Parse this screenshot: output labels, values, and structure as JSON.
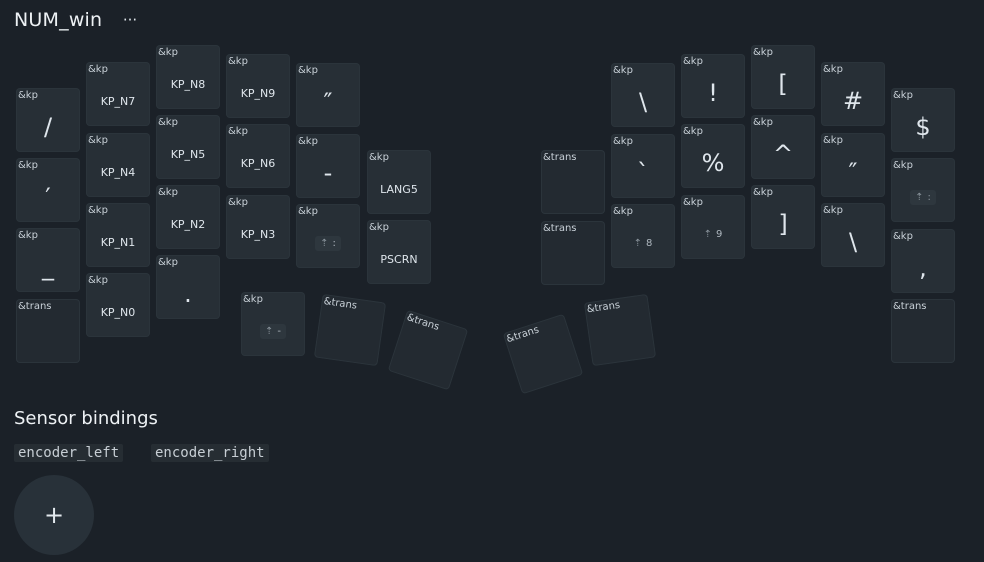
{
  "layer": {
    "title": "NUM_win",
    "menu": "···"
  },
  "keys": {
    "k1": {
      "behavior": "&kp",
      "param": "/"
    },
    "k2": {
      "behavior": "&kp",
      "param": "KP_N7"
    },
    "k3": {
      "behavior": "&kp",
      "param": "KP_N8"
    },
    "k4": {
      "behavior": "&kp",
      "param": "KP_N9"
    },
    "k5": {
      "behavior": "&kp",
      "param": "″"
    },
    "k6": {
      "behavior": "&kp",
      "param": "\\"
    },
    "k7": {
      "behavior": "&kp",
      "param": "!"
    },
    "k8": {
      "behavior": "&kp",
      "param": "["
    },
    "k9": {
      "behavior": "&kp",
      "param": "#"
    },
    "k10": {
      "behavior": "&kp",
      "param": "$"
    },
    "k11": {
      "behavior": "&kp",
      "param": "′"
    },
    "k12": {
      "behavior": "&kp",
      "param": "KP_N4"
    },
    "k13": {
      "behavior": "&kp",
      "param": "KP_N5"
    },
    "k14": {
      "behavior": "&kp",
      "param": "KP_N6"
    },
    "k15": {
      "behavior": "&kp",
      "param": "-"
    },
    "k16": {
      "behavior": "&kp",
      "param": "LANG5"
    },
    "k17": {
      "behavior": "&trans",
      "param": ""
    },
    "k18": {
      "behavior": "&kp",
      "param": "`"
    },
    "k19": {
      "behavior": "&kp",
      "param": "%"
    },
    "k20": {
      "behavior": "&kp",
      "param": "^"
    },
    "k21": {
      "behavior": "&kp",
      "param": "″"
    },
    "k22": {
      "behavior": "&kp",
      "param": "",
      "mod": ":"
    },
    "k23": {
      "behavior": "&kp",
      "param": "_"
    },
    "k24": {
      "behavior": "&kp",
      "param": "KP_N1"
    },
    "k25": {
      "behavior": "&kp",
      "param": "KP_N2"
    },
    "k26": {
      "behavior": "&kp",
      "param": "KP_N3"
    },
    "k27": {
      "behavior": "&kp",
      "param": "",
      "mod": ":"
    },
    "k28": {
      "behavior": "&kp",
      "param": "PSCRN"
    },
    "k29": {
      "behavior": "&trans",
      "param": ""
    },
    "k30": {
      "behavior": "&kp",
      "param": "",
      "mod": "8"
    },
    "k31": {
      "behavior": "&kp",
      "param": "",
      "mod": "9"
    },
    "k32": {
      "behavior": "&kp",
      "param": "]"
    },
    "k33": {
      "behavior": "&kp",
      "param": "\\"
    },
    "k34": {
      "behavior": "&kp",
      "param": ","
    },
    "k35": {
      "behavior": "&trans",
      "param": ""
    },
    "k36": {
      "behavior": "&kp",
      "param": "KP_N0"
    },
    "k37": {
      "behavior": "&kp",
      "param": "."
    },
    "k38": {
      "behavior": "&kp",
      "param": "",
      "mod": "-"
    },
    "k39": {
      "behavior": "&trans",
      "param": ""
    },
    "k40": {
      "behavior": "&trans",
      "param": ""
    },
    "k41": {
      "behavior": "&trans",
      "param": ""
    },
    "k42": {
      "behavior": "&trans",
      "param": ""
    },
    "k43": {
      "behavior": "&trans",
      "param": ""
    }
  },
  "sensor": {
    "title": "Sensor bindings",
    "encoders": [
      "encoder_left",
      "encoder_right"
    ],
    "add_label": "+"
  },
  "icons": {
    "modifier": "shift-arrow-icon"
  }
}
